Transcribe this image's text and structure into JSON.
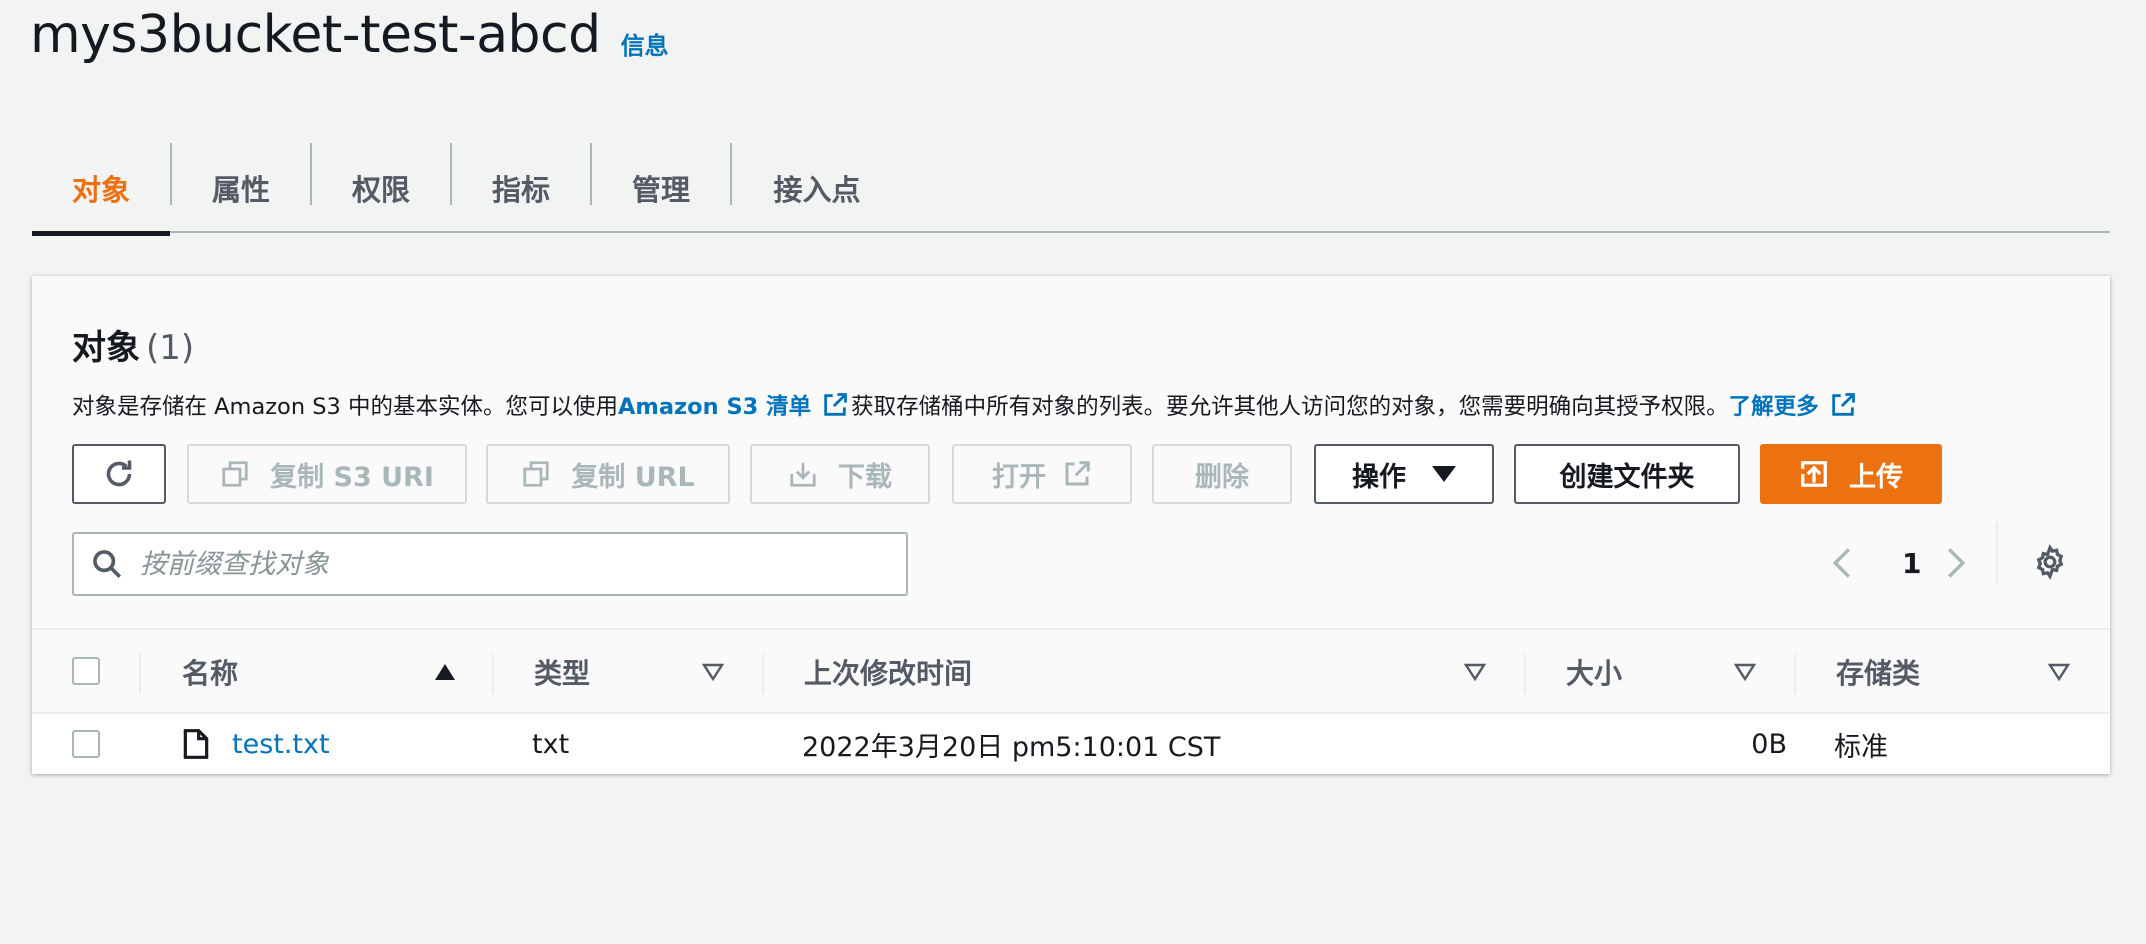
{
  "header": {
    "bucket_name": "mys3bucket-test-abcd",
    "info_label": "信息"
  },
  "tabs": [
    {
      "label": "对象",
      "active": true
    },
    {
      "label": "属性",
      "active": false
    },
    {
      "label": "权限",
      "active": false
    },
    {
      "label": "指标",
      "active": false
    },
    {
      "label": "管理",
      "active": false
    },
    {
      "label": "接入点",
      "active": false
    }
  ],
  "objects_panel": {
    "title": "对象",
    "count": "(1)",
    "description": {
      "part1": "对象是存储在 Amazon S3 中的基本实体。您可以使用 ",
      "link1": "Amazon S3 清单",
      "part2": "获取存储桶中所有对象的列表。要允许其他人访问您的对象，您需要明确向其授予权限。",
      "link2": "了解更多"
    },
    "toolbar": {
      "copy_s3_uri": "复制 S3 URI",
      "copy_url": "复制 URL",
      "download": "下载",
      "open": "打开",
      "delete": "删除",
      "actions": "操作",
      "create_folder": "创建文件夹",
      "upload": "上传"
    },
    "search": {
      "placeholder": "按前缀查找对象",
      "value": ""
    },
    "pagination": {
      "current_page": "1"
    },
    "table": {
      "columns": [
        "名称",
        "类型",
        "上次修改时间",
        "大小",
        "存储类"
      ],
      "rows": [
        {
          "name": "test.txt",
          "type": "txt",
          "last_modified": "2022年3月20日 pm5:10:01 CST",
          "size": "0B",
          "storage_class": "标准"
        }
      ]
    }
  },
  "colors": {
    "accent_orange": "#ec7211",
    "link_blue": "#0073bb",
    "text_dark": "#16191f",
    "text_grey": "#545b64",
    "disabled_grey": "#aab7b8",
    "background": "#f2f3f3"
  }
}
